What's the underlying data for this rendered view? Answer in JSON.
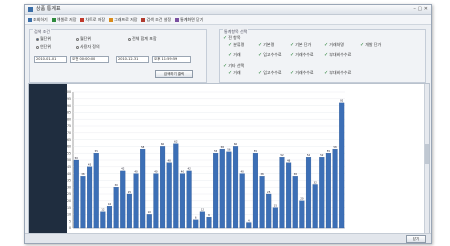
{
  "window": {
    "title": "상품 통계표"
  },
  "toolbar": {
    "items": [
      {
        "label": "조회하기",
        "icon": "search-icon",
        "color": "#3a6ea8"
      },
      {
        "label": "엑셀로 저장",
        "icon": "excel-icon",
        "color": "#2e8b3d"
      },
      {
        "label": "차트로 저장",
        "icon": "chart-icon",
        "color": "#c0392b"
      },
      {
        "label": "그래프로 저장",
        "icon": "graph-icon",
        "color": "#d98c1b"
      },
      {
        "label": "검색 조건 설정",
        "icon": "filter-icon",
        "color": "#b03a2e"
      },
      {
        "label": "통계화면 닫기",
        "icon": "close-icon",
        "color": "#7a4fa0"
      }
    ]
  },
  "left_panel": {
    "caption": "검색 조건",
    "radios": [
      {
        "label": "월단위",
        "on": true
      },
      {
        "label": "월단위",
        "on": false
      },
      {
        "label": "전체 합계 포함",
        "on": false
      },
      {
        "label": "연단위",
        "on": false
      },
      {
        "label": "사용자 정의",
        "on": false
      }
    ],
    "from_date": "2010-01-01",
    "from_time": "오전 00:00:00",
    "to_date": "2010-12-31",
    "to_time": "오후 11:59:59",
    "search_label": "검색하기 클릭"
  },
  "right_panel": {
    "caption": "통계항목 선택",
    "group1_label": "전 항목",
    "group1": [
      "분류명",
      "기본명",
      "기본 단가",
      "거래처명",
      "개발 단가",
      "거래",
      "입고수수료",
      "거래수수료",
      "부대비수수료"
    ],
    "group2_label": "기타 선택",
    "group2": [
      "거래",
      "입고수수료",
      "거래수수료",
      "부대비수수료"
    ]
  },
  "chart_data": {
    "type": "bar",
    "ylim": [
      0,
      100
    ],
    "yticks": [
      0,
      5,
      10,
      15,
      20,
      25,
      30,
      35,
      40,
      45,
      50,
      55,
      60,
      65,
      70,
      75,
      80,
      85,
      90,
      95,
      100
    ],
    "values": [
      50,
      38,
      45,
      55,
      12,
      16,
      30,
      42,
      25,
      40,
      58,
      10,
      40,
      60,
      48,
      62,
      40,
      42,
      6,
      12,
      8,
      55,
      58,
      56,
      60,
      40,
      4,
      55,
      38,
      25,
      15,
      52,
      48,
      38,
      20,
      52,
      32,
      52,
      55,
      58,
      92
    ],
    "color": "#3c6fb6",
    "outline": "#2c5590"
  },
  "statusbar": {
    "close_label": "닫기"
  }
}
